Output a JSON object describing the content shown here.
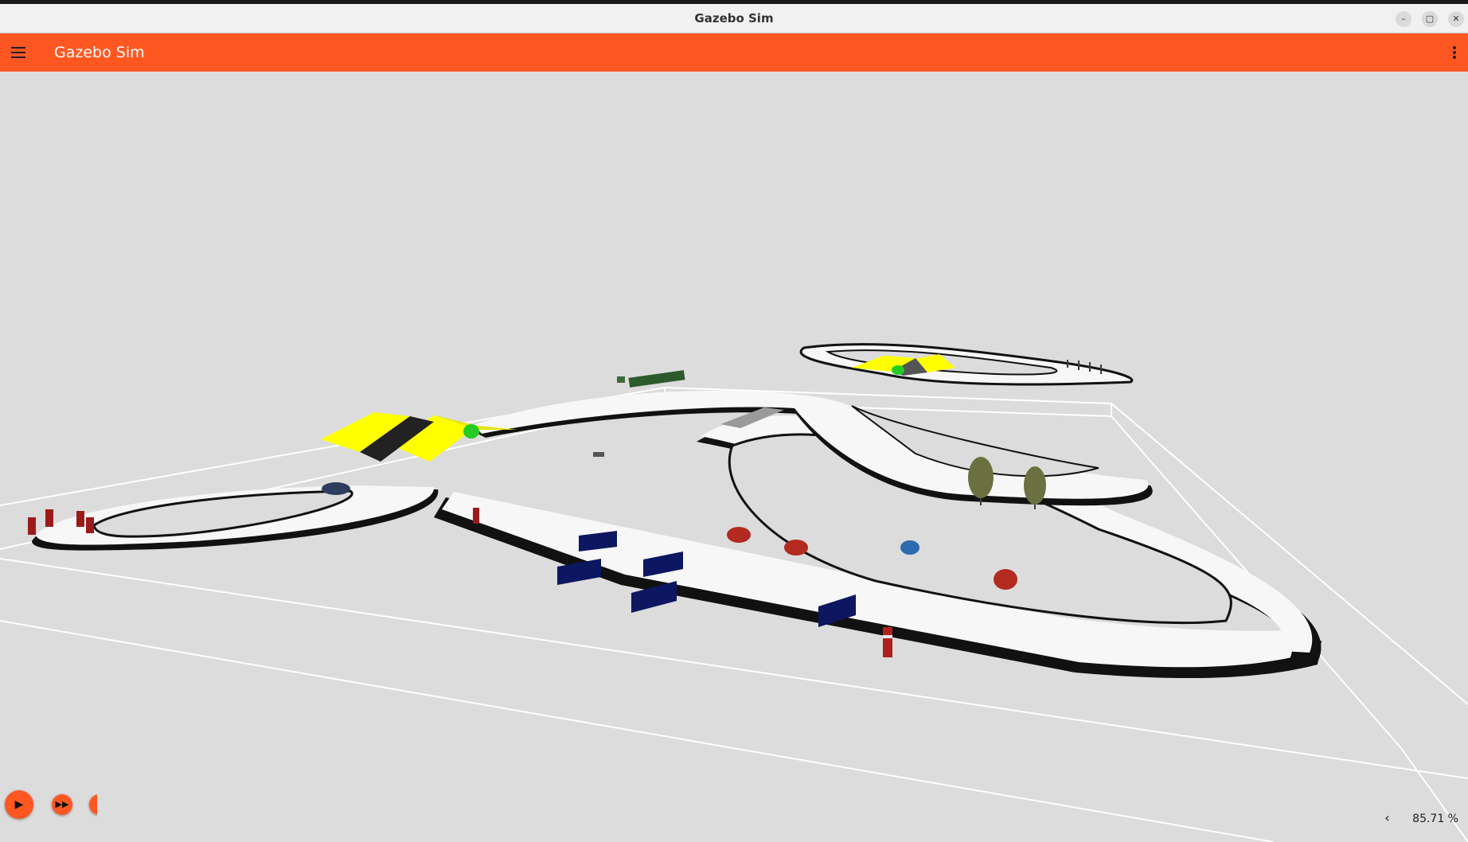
{
  "window": {
    "title": "Gazebo Sim",
    "minimize_label": "–",
    "maximize_label": "▢",
    "close_label": "✕"
  },
  "appbar": {
    "title": "Gazebo Sim"
  },
  "sim_controls": {
    "play_icon": "play-icon",
    "step_icon": "fast-forward-icon"
  },
  "stats": {
    "real_time_factor": "85.71 %",
    "expand_icon": "chevron-left-icon"
  },
  "colors": {
    "accent": "#ff5722",
    "scene_bg": "#dcdcdc",
    "ramp": "#ffff00",
    "obstacle": "#0d1660"
  }
}
